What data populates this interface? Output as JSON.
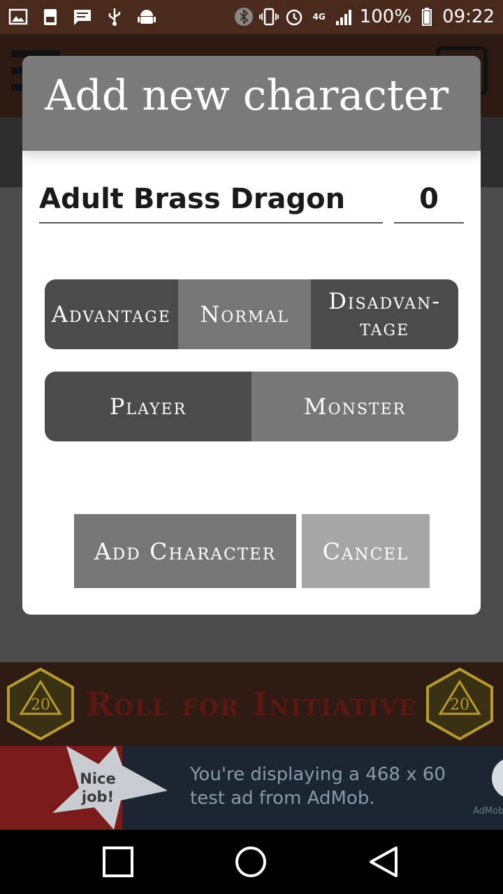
{
  "status_bar": {
    "battery": "100%",
    "time": "09:22",
    "network": "4G",
    "icons": [
      "image-icon",
      "storage-icon",
      "message-icon",
      "usb-icon",
      "android-icon",
      "bluetooth-icon",
      "vibrate-icon",
      "alarm-icon",
      "signal-icon",
      "battery-icon"
    ]
  },
  "dialog": {
    "title": "Add new character",
    "name_value": "Adult Brass Dragon",
    "initiative_value": "0",
    "roll_mode": {
      "options": [
        "Advantage",
        "Normal",
        "Disadvan-tage"
      ],
      "selected": "Normal"
    },
    "character_type": {
      "options": [
        "Player",
        "Monster"
      ],
      "selected": "Monster"
    },
    "add_label": "Add Character",
    "cancel_label": "Cancel"
  },
  "banner": {
    "title": "Roll for Initiative",
    "die_label": "20"
  },
  "ad": {
    "badge_text": "Nice job!",
    "text": "You're displaying a 468 x 60 test ad from AdMob.",
    "brand": "AdMob"
  },
  "nav_bar": {
    "buttons": [
      "recents-icon",
      "home-icon",
      "back-icon"
    ]
  },
  "colors": {
    "title_bar": "#7a7a7a",
    "segment_dark": "#4b4b4b",
    "segment_selected": "#777777",
    "cancel": "#a6a6a6",
    "banner_text": "#5a1810"
  }
}
